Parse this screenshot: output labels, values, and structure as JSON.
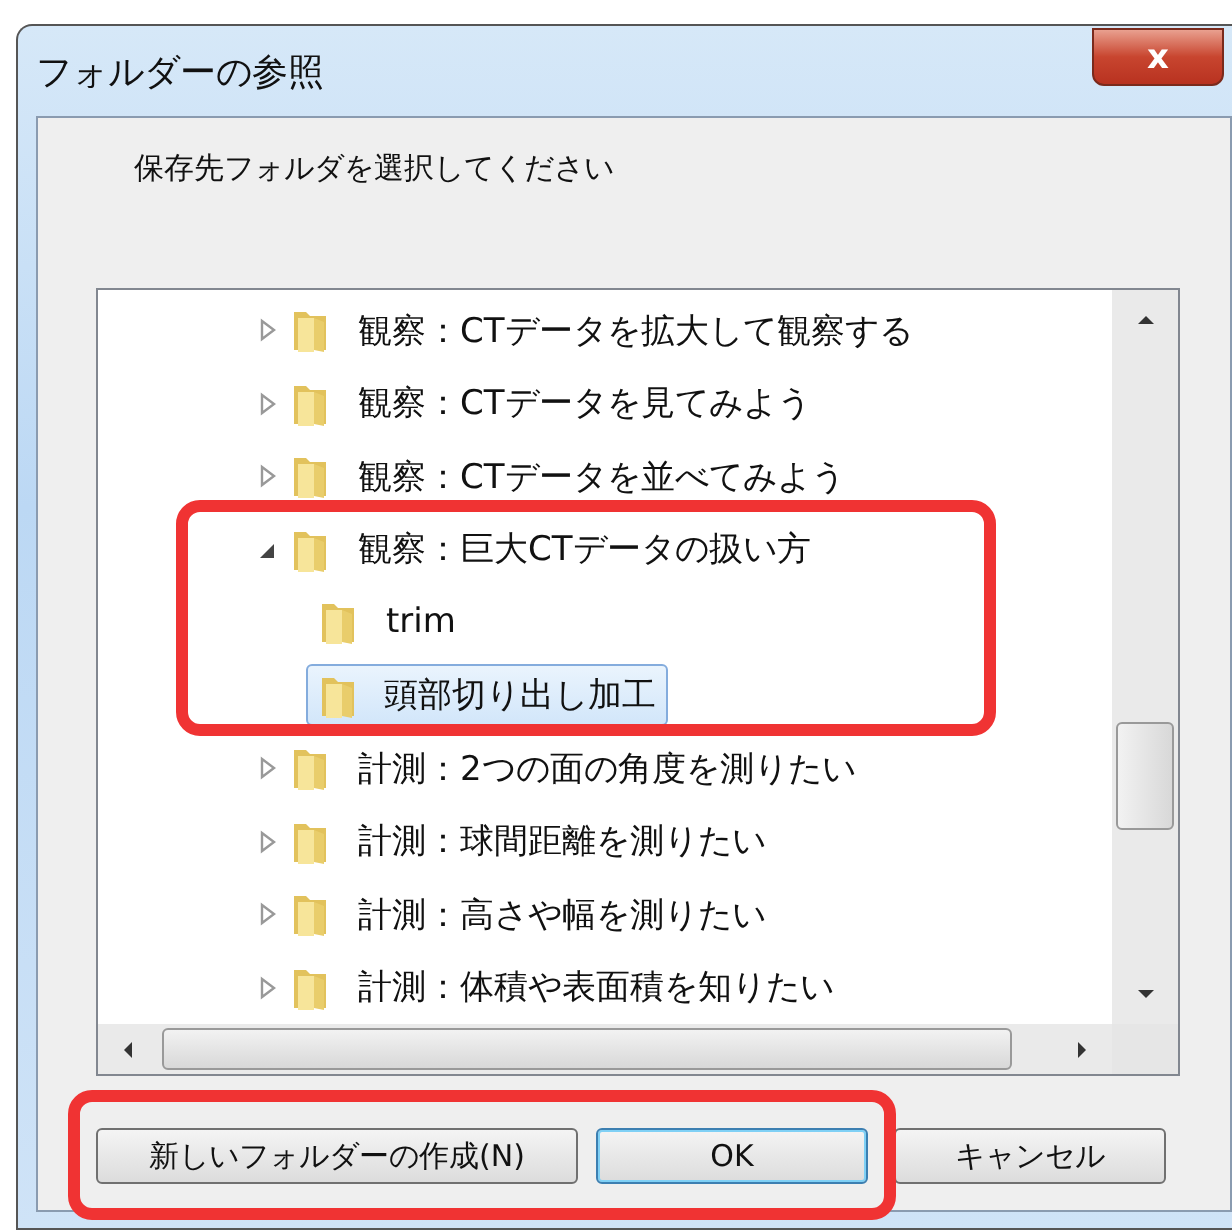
{
  "window": {
    "title": "フォルダーの参照",
    "close": "x"
  },
  "prompt": "保存先フォルダを選択してください",
  "tree": [
    {
      "label": "観察：CTデータを拡大して観察する",
      "expanded": false,
      "selected": false
    },
    {
      "label": "観察：CTデータを見てみよう",
      "expanded": false,
      "selected": false
    },
    {
      "label": "観察：CTデータを並べてみよう",
      "expanded": false,
      "selected": false
    },
    {
      "label": "観察：巨大CTデータの扱い方",
      "expanded": true,
      "selected": false,
      "children": [
        {
          "label": "trim",
          "selected": false
        },
        {
          "label": "頭部切り出し加工",
          "selected": true
        }
      ]
    },
    {
      "label": "計測：2つの面の角度を測りたい",
      "expanded": false,
      "selected": false
    },
    {
      "label": "計測：球間距離を測りたい",
      "expanded": false,
      "selected": false
    },
    {
      "label": "計測：高さや幅を測りたい",
      "expanded": false,
      "selected": false
    },
    {
      "label": "計測：体積や表面積を知りたい",
      "expanded": false,
      "selected": false
    }
  ],
  "buttons": [
    {
      "label": "新しいフォルダーの作成(N)",
      "default": false
    },
    {
      "label": "OK",
      "default": true
    },
    {
      "label": "キャンセル",
      "default": false
    }
  ]
}
